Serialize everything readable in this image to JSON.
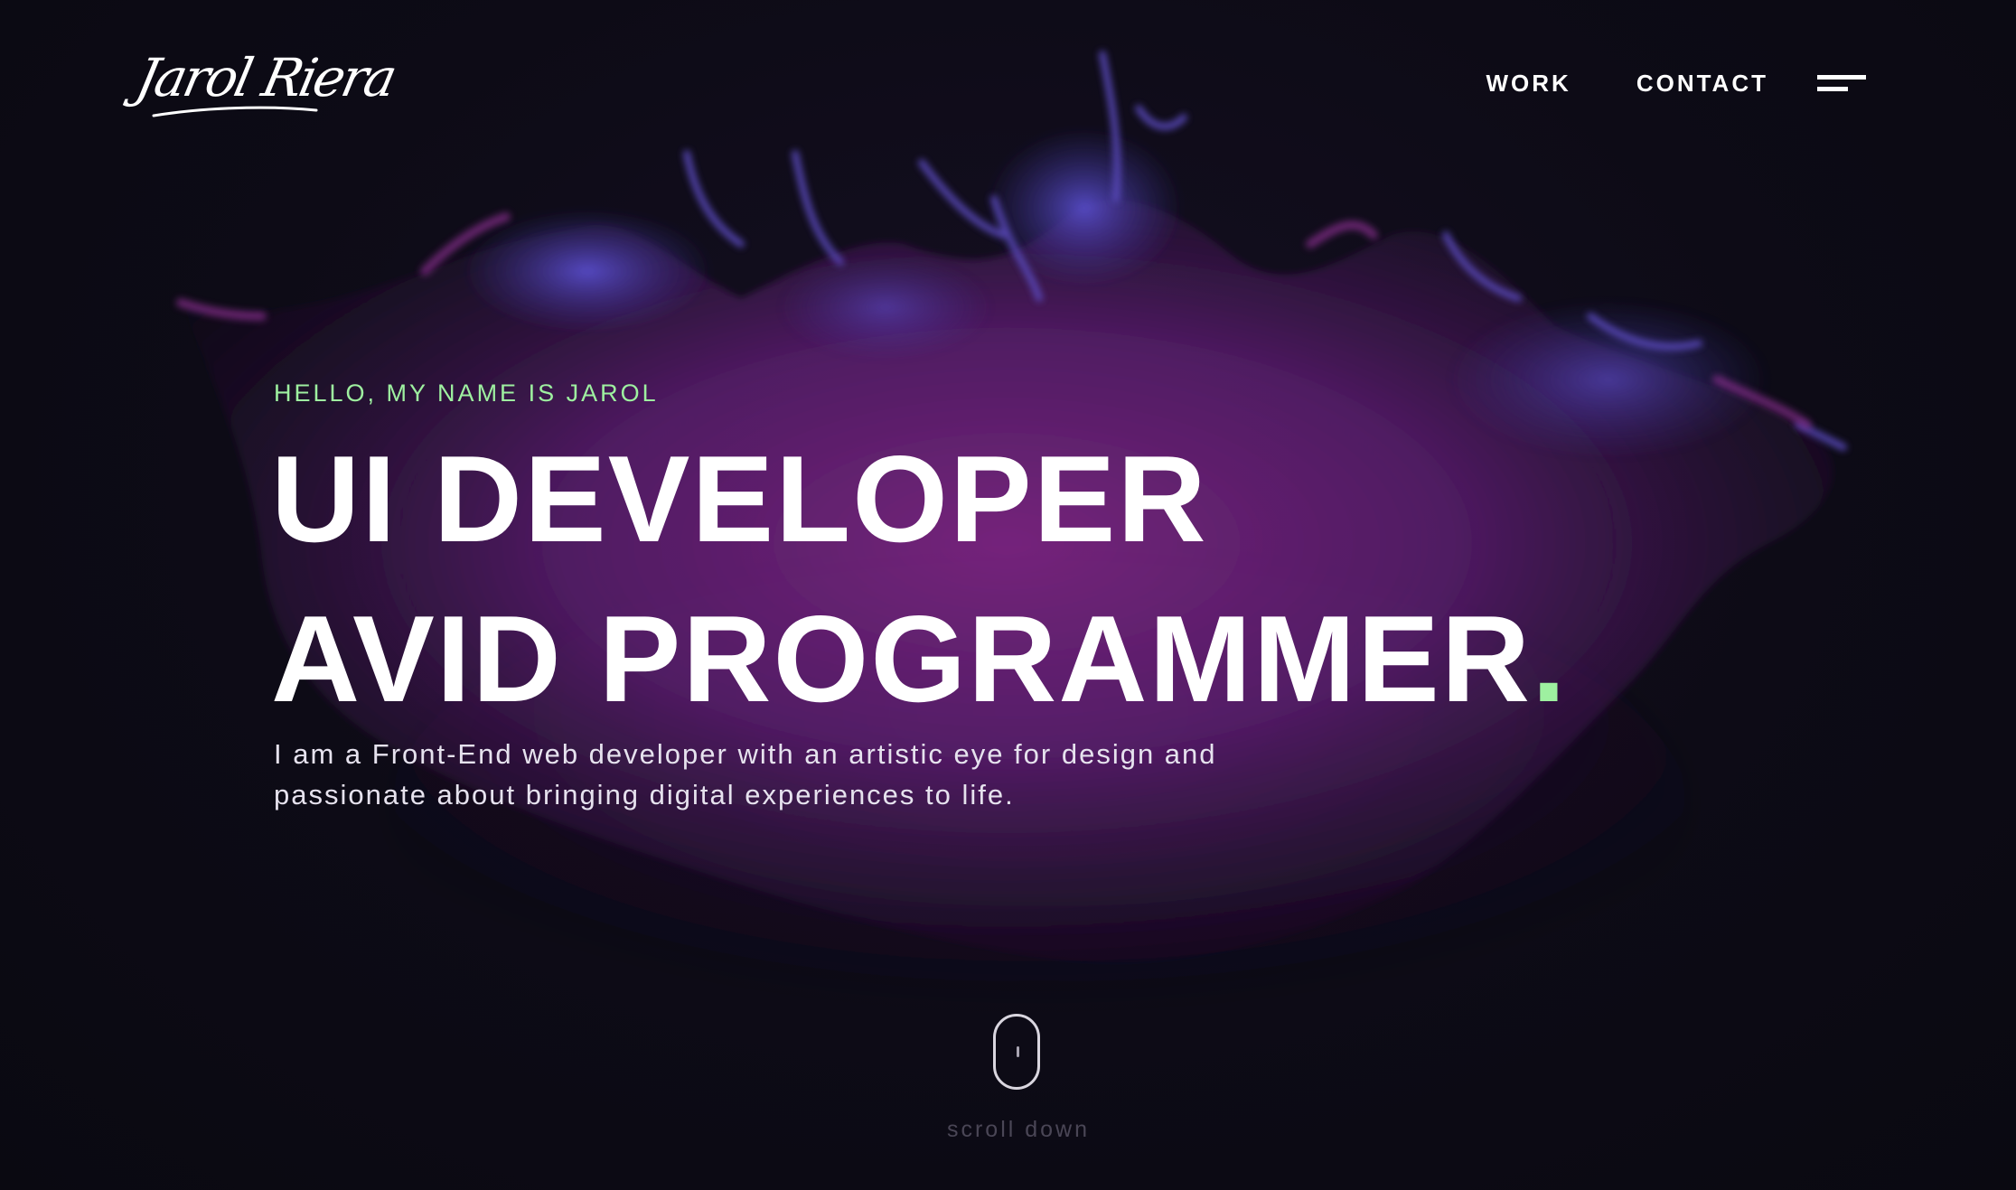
{
  "header": {
    "logo_text": "Jarol Riera",
    "nav": [
      {
        "label": "WORK"
      },
      {
        "label": "CONTACT"
      }
    ],
    "menu_icon": "hamburger-menu-icon"
  },
  "hero": {
    "intro": "HELLO, MY NAME IS JAROL",
    "headline_line1": "UI DEVELOPER",
    "headline_line2": "AVID PROGRAMMER",
    "headline_dot": ".",
    "description": "I am a Front-End web developer with an artistic eye for design and passionate about bringing digital experiences to life."
  },
  "scroll": {
    "label": "scroll down",
    "icon": "mouse-scroll-icon"
  },
  "colors": {
    "background": "#0b0a13",
    "accent": "#9ef0a0",
    "text": "#ffffff",
    "splash_purple": "#7b2a8a",
    "splash_blue": "#4a3fb0"
  }
}
